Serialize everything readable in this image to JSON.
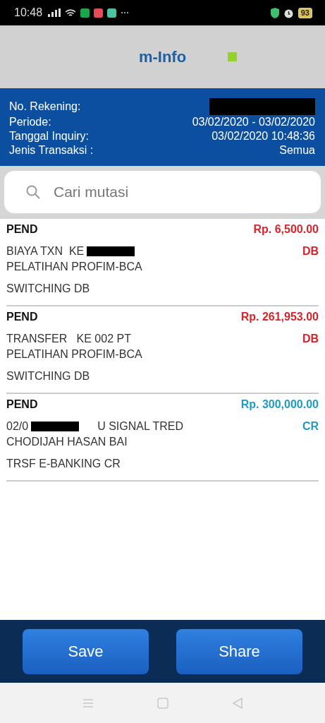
{
  "status_bar": {
    "time": "10:48",
    "battery": "93"
  },
  "header": {
    "title": "m-Info"
  },
  "info": [
    {
      "label": "No. Rekening:",
      "redacted": true
    },
    {
      "label": "Periode:",
      "value": "03/02/2020 - 03/02/2020"
    },
    {
      "label": "Tanggal Inquiry:",
      "value": "03/02/2020 10:48:36"
    },
    {
      "label": "Jenis Transaksi :",
      "value": "Semua"
    }
  ],
  "search": {
    "placeholder": "Cari mutasi"
  },
  "transactions": [
    {
      "status": "PEND",
      "amount": "Rp. 6,500.00",
      "type": "DB",
      "kind": "debit",
      "lines": [
        [
          {
            "kind": "text",
            "text": "BIAYA TXN  KE"
          },
          {
            "kind": "redacted"
          }
        ],
        [
          {
            "kind": "text",
            "text": "PELATIHAN PROFIM-BCA"
          }
        ]
      ],
      "note": "SWITCHING DB"
    },
    {
      "status": "PEND",
      "amount": "Rp. 261,953.00",
      "type": "DB",
      "kind": "debit",
      "lines": [
        [
          {
            "kind": "text",
            "text": "TRANSFER   KE 002 PT"
          }
        ],
        [
          {
            "kind": "text",
            "text": "PELATIHAN PROFIM-BCA"
          }
        ]
      ],
      "note": "SWITCHING DB"
    },
    {
      "status": "PEND",
      "amount": "Rp. 300,000.00",
      "type": "CR",
      "kind": "credit",
      "lines": [
        [
          {
            "kind": "text",
            "text": "02/0"
          },
          {
            "kind": "redacted"
          },
          {
            "kind": "text",
            "text": "U SIGNAL TRED"
          }
        ],
        [
          {
            "kind": "text",
            "text": "CHODIJAH HASAN BAI"
          }
        ]
      ],
      "note": "TRSF E-BANKING CR"
    }
  ],
  "buttons": [
    "Save",
    "Share"
  ]
}
